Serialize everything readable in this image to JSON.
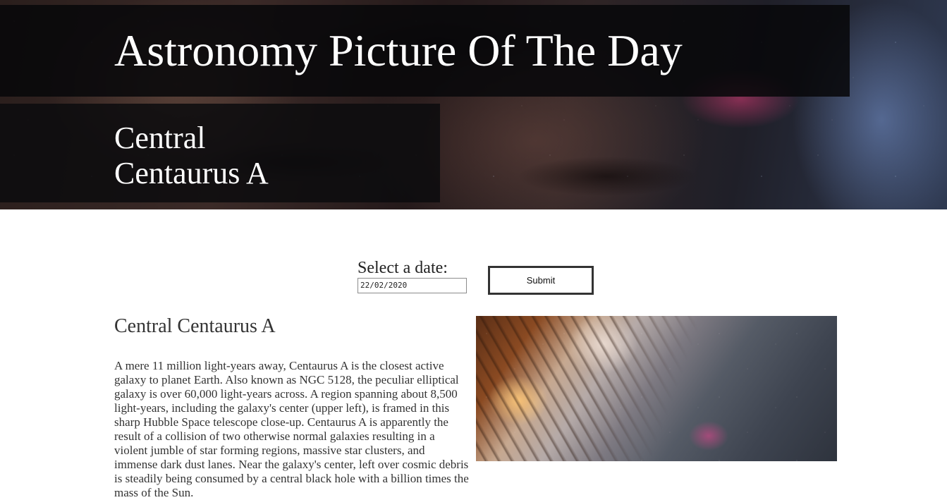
{
  "header": {
    "site_title": "Astronomy Picture Of The Day",
    "picture_title": "Central Centaurus A"
  },
  "date_form": {
    "label": "Select a date:",
    "date_value": "22/02/2020",
    "submit_label": "Submit"
  },
  "article": {
    "title": "Central Centaurus A",
    "explanation": "A mere 11 million light-years away, Centaurus A is the closest active galaxy to planet Earth. Also known as NGC 5128, the peculiar elliptical galaxy is over 60,000 light-years across. A region spanning about 8,500 light-years, including the galaxy's center (upper left), is framed in this sharp Hubble Space telescope close-up. Centaurus A is apparently the result of a collision of two otherwise normal galaxies resulting in a violent jumble of star forming regions, massive star clusters, and immense dark dust lanes. Near the galaxy's center, left over cosmic debris is steadily being consumed by a central black hole with a billion times the mass of the Sun."
  }
}
